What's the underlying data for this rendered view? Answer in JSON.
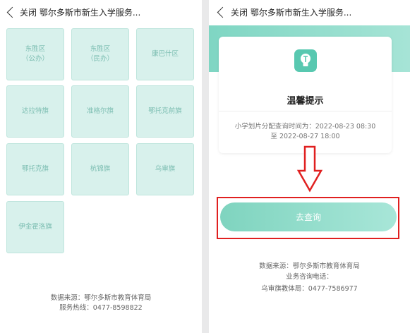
{
  "left": {
    "nav": {
      "back_icon": "chevron-left-icon",
      "title": "关闭 鄂尔多斯市新生入学服务..."
    },
    "districts": [
      {
        "name": "东胜区",
        "sub": "（公办）"
      },
      {
        "name": "东胜区",
        "sub": "（民办）"
      },
      {
        "name": "康巴什区",
        "sub": ""
      },
      {
        "name": "达拉特旗",
        "sub": ""
      },
      {
        "name": "准格尔旗",
        "sub": ""
      },
      {
        "name": "鄂托克前旗",
        "sub": ""
      },
      {
        "name": "鄂托克旗",
        "sub": ""
      },
      {
        "name": "杭锦旗",
        "sub": ""
      },
      {
        "name": "乌审旗",
        "sub": ""
      },
      {
        "name": "伊金霍洛旗",
        "sub": ""
      }
    ],
    "footer": {
      "source": "数据来源：鄂尔多斯市教育体育局",
      "hotline": "服务热线：0477-8598822"
    }
  },
  "right": {
    "nav": {
      "back_icon": "chevron-left-icon",
      "title": "关闭 鄂尔多斯市新生入学服务..."
    },
    "card": {
      "icon": "lightbulb-icon",
      "title": "温馨提示",
      "line1": "小学划片分配查询时间为：2022-08-23 08:30",
      "line2": "至 2022-08-27 18:00"
    },
    "arrow_icon": "arrow-down-icon",
    "query_button": "去查询",
    "footer": {
      "source": "数据来源：鄂尔多斯市教育体育局",
      "consult": "业务咨询电话：",
      "phone": "乌审旗教体局：0477-7586977"
    }
  },
  "colors": {
    "accent": "#7fd6c3",
    "tile_bg": "#d8f1ec",
    "tile_text": "#7bbdb1",
    "highlight": "#e02020"
  }
}
